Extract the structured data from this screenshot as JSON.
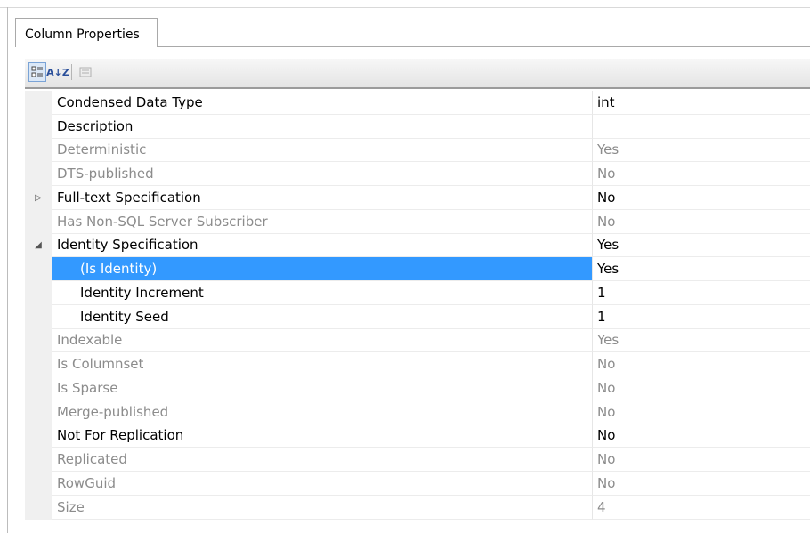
{
  "tab": {
    "label": "Column Properties"
  },
  "toolbar": {
    "categorized_icon": "categorized-icon",
    "alphabetical_icon": "alphabetical-icon",
    "alphabetical_glyph": "A↓Z",
    "property_pages_icon": "property-pages-icon"
  },
  "properties": [
    {
      "name": "Condensed Data Type",
      "value": "int",
      "enabled": true,
      "expander": "",
      "sub": false,
      "selected": false
    },
    {
      "name": "Description",
      "value": "",
      "enabled": true,
      "expander": "",
      "sub": false,
      "selected": false
    },
    {
      "name": "Deterministic",
      "value": "Yes",
      "enabled": false,
      "expander": "",
      "sub": false,
      "selected": false
    },
    {
      "name": "DTS-published",
      "value": "No",
      "enabled": false,
      "expander": "",
      "sub": false,
      "selected": false
    },
    {
      "name": "Full-text Specification",
      "value": "No",
      "enabled": true,
      "expander": "▷",
      "sub": false,
      "selected": false
    },
    {
      "name": "Has Non-SQL Server Subscriber",
      "value": "No",
      "enabled": false,
      "expander": "",
      "sub": false,
      "selected": false
    },
    {
      "name": "Identity Specification",
      "value": "Yes",
      "enabled": true,
      "expander": "◢",
      "sub": false,
      "selected": false
    },
    {
      "name": "(Is Identity)",
      "value": "Yes",
      "enabled": true,
      "expander": "",
      "sub": true,
      "selected": true
    },
    {
      "name": "Identity Increment",
      "value": "1",
      "enabled": true,
      "expander": "",
      "sub": true,
      "selected": false
    },
    {
      "name": "Identity Seed",
      "value": "1",
      "enabled": true,
      "expander": "",
      "sub": true,
      "selected": false
    },
    {
      "name": "Indexable",
      "value": "Yes",
      "enabled": false,
      "expander": "",
      "sub": false,
      "selected": false
    },
    {
      "name": "Is Columnset",
      "value": "No",
      "enabled": false,
      "expander": "",
      "sub": false,
      "selected": false
    },
    {
      "name": "Is Sparse",
      "value": "No",
      "enabled": false,
      "expander": "",
      "sub": false,
      "selected": false
    },
    {
      "name": "Merge-published",
      "value": "No",
      "enabled": false,
      "expander": "",
      "sub": false,
      "selected": false
    },
    {
      "name": "Not For Replication",
      "value": "No",
      "enabled": true,
      "expander": "",
      "sub": false,
      "selected": false
    },
    {
      "name": "Replicated",
      "value": "No",
      "enabled": false,
      "expander": "",
      "sub": false,
      "selected": false
    },
    {
      "name": "RowGuid",
      "value": "No",
      "enabled": false,
      "expander": "",
      "sub": false,
      "selected": false
    },
    {
      "name": "Size",
      "value": "4",
      "enabled": false,
      "expander": "",
      "sub": false,
      "selected": false
    }
  ]
}
